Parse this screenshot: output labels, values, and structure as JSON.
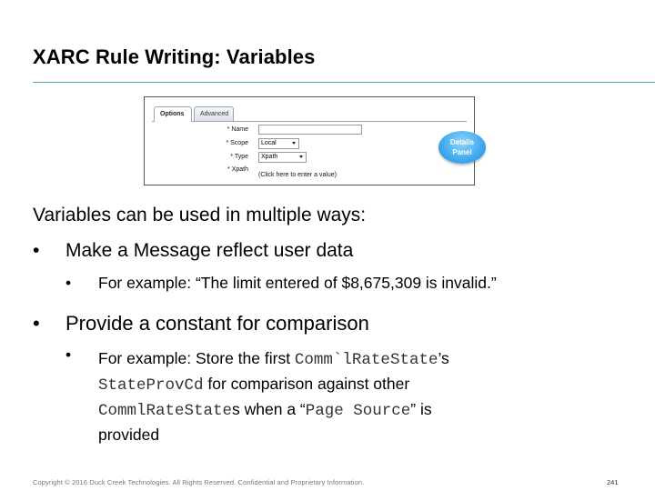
{
  "slide": {
    "title": "XARC Rule Writing: Variables",
    "intro": "Variables can be used in multiple ways:",
    "bullet1": "Make a Message reflect user data",
    "bullet1_sub": "For example: “The limit entered of $8,675,309 is invalid.”",
    "bullet2": "Provide a constant for comparison",
    "bullet2_sub": {
      "part1": "For example: Store the first ",
      "code1": "Comm`lRateState",
      "part2": "’s",
      "code2": "StateProvCd",
      "part3": " for comparison against other",
      "code3": "CommlRateState",
      "part4": "s when a “",
      "code4": "Page Source",
      "part5": "” is",
      "part6": "provided"
    },
    "bullet_symbol": "•",
    "footer": "Copyright © 2016 Duck Creek Technologies. All Rights Reserved. Confidential and Proprietary Information.",
    "page_number": "241"
  },
  "panel": {
    "tabs": [
      {
        "label": "Options",
        "active": true
      },
      {
        "label": "Advanced",
        "active": false
      }
    ],
    "fields": {
      "name_label": "* Name",
      "name_value": "",
      "scope_label": "* Scope",
      "scope_value": "Local",
      "type_label": "* Type",
      "type_value": "Xpath",
      "xpath_label": "* Xpath",
      "xpath_link": "(Click here to enter a value)"
    },
    "details_button": "Details Panel"
  },
  "colors": {
    "title_rule": "#5aa9b8",
    "details_button": "#45aef0",
    "footer_text": "#777777"
  }
}
